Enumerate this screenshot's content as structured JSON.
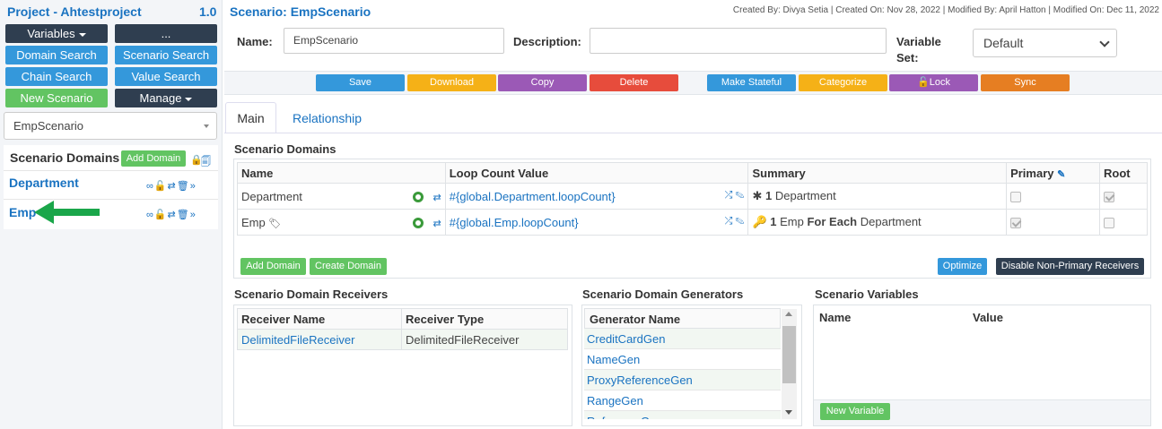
{
  "project": {
    "title": "Project - Ahtestproject",
    "version": "1.0"
  },
  "left_buttons": {
    "variables": "Variables",
    "more": "...",
    "domain_search": "Domain Search",
    "scenario_search": "Scenario Search",
    "chain_search": "Chain Search",
    "value_search": "Value Search",
    "new_scenario": "New Scenario",
    "manage": "Manage"
  },
  "scenario_select": {
    "value": "EmpScenario"
  },
  "left_domains": {
    "title": "Scenario Domains",
    "add_label": "Add Domain",
    "items": [
      {
        "label": "Department"
      },
      {
        "label": "Emp"
      }
    ]
  },
  "header": {
    "scenario_title": "Scenario: EmpScenario",
    "meta": "Created By: Divya Setia | Created On: Nov 28, 2022 | Modified By: April Hatton | Modified On: Dec 11, 2022"
  },
  "form": {
    "name_label": "Name:",
    "name_value": "EmpScenario",
    "description_label": "Description:",
    "description_value": "",
    "variable_set_label_1": "Variable",
    "variable_set_label_2": "Set:",
    "variable_set_value": "Default"
  },
  "toolbar": {
    "save": "Save",
    "download": "Download",
    "copy": "Copy",
    "delete": "Delete",
    "make_stateful": "Make Stateful",
    "categorize": "Categorize",
    "lock": "Lock",
    "sync": "Sync"
  },
  "colors": {
    "save": "#3498db",
    "download": "#f5b117",
    "copy": "#9b59b6",
    "delete": "#e74c3c",
    "make_stateful": "#3498db",
    "categorize": "#f5b117",
    "lock": "#9b59b6",
    "sync": "#e67e22"
  },
  "tabs": {
    "main": "Main",
    "relationship": "Relationship"
  },
  "domains_table": {
    "title": "Scenario Domains",
    "headers": {
      "name": "Name",
      "loop": "Loop Count Value",
      "summary": "Summary",
      "primary": "Primary",
      "root": "Root"
    },
    "rows": [
      {
        "name": "Department",
        "loop": "#{global.Department.loopCount}",
        "summary_count": "1",
        "summary_text": "Department",
        "summary_bold": "",
        "summary_tail": "",
        "primary": false,
        "root": true
      },
      {
        "name": "Emp",
        "loop": "#{global.Emp.loopCount}",
        "summary_count": "1",
        "summary_text": "Emp",
        "summary_bold": "For Each",
        "summary_tail": "Department",
        "primary": true,
        "root": false
      }
    ],
    "add_domain": "Add Domain",
    "create_domain": "Create Domain",
    "optimize": "Optimize",
    "disable_non_primary": "Disable Non-Primary Receivers"
  },
  "receivers": {
    "title": "Scenario Domain Receivers",
    "headers": {
      "name": "Receiver Name",
      "type": "Receiver Type"
    },
    "rows": [
      {
        "name": "DelimitedFileReceiver",
        "type": "DelimitedFileReceiver"
      }
    ]
  },
  "generators": {
    "title": "Scenario Domain Generators",
    "header": "Generator Name",
    "items": [
      "CreditCardGen",
      "NameGen",
      "ProxyReferenceGen",
      "RangeGen",
      "ReferenceGen"
    ]
  },
  "variables": {
    "title": "Scenario Variables",
    "headers": {
      "name": "Name",
      "value": "Value"
    },
    "new_variable": "New Variable"
  }
}
